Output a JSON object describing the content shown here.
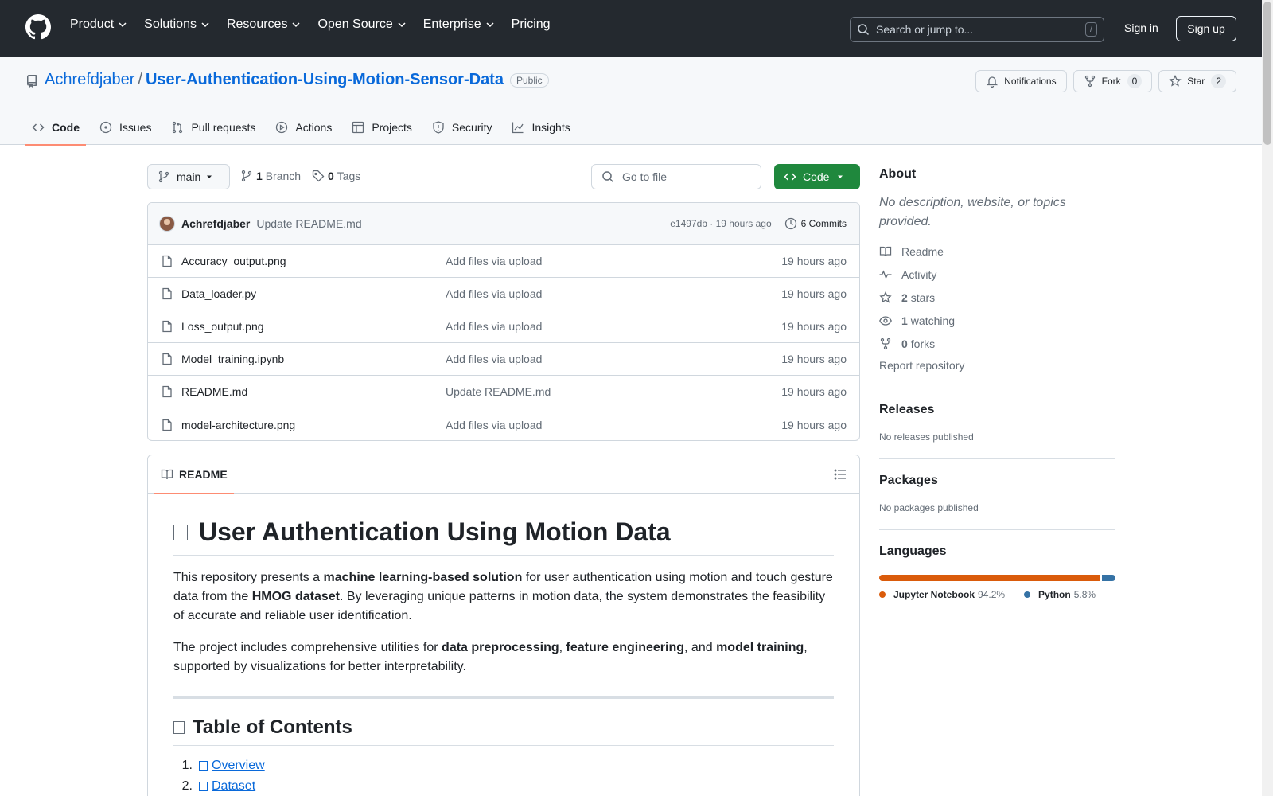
{
  "header": {
    "nav": [
      "Product",
      "Solutions",
      "Resources",
      "Open Source",
      "Enterprise",
      "Pricing"
    ],
    "search_placeholder": "Search or jump to...",
    "search_shortcut": "/",
    "signin": "Sign in",
    "signup": "Sign up"
  },
  "repo": {
    "owner": "Achrefdjaber",
    "separator": "/",
    "name": "User-Authentication-Using-Motion-Sensor-Data",
    "visibility": "Public",
    "notifications": "Notifications",
    "fork_label": "Fork",
    "fork_count": "0",
    "star_label": "Star",
    "star_count": "2"
  },
  "tabs": [
    "Code",
    "Issues",
    "Pull requests",
    "Actions",
    "Projects",
    "Security",
    "Insights"
  ],
  "toolbar": {
    "branch": "main",
    "branch_count": "1",
    "branch_label": "Branch",
    "tag_count": "0",
    "tag_label": "Tags",
    "goto_placeholder": "Go to file",
    "code_button": "Code"
  },
  "commit": {
    "author": "Achrefdjaber",
    "message": "Update README.md",
    "meta": "e1497db · 19 hours ago",
    "commits": "6 Commits"
  },
  "files": [
    {
      "name": "Accuracy_output.png",
      "message": "Add files via upload",
      "time": "19 hours ago"
    },
    {
      "name": "Data_loader.py",
      "message": "Add files via upload",
      "time": "19 hours ago"
    },
    {
      "name": "Loss_output.png",
      "message": "Add files via upload",
      "time": "19 hours ago"
    },
    {
      "name": "Model_training.ipynb",
      "message": "Add files via upload",
      "time": "19 hours ago"
    },
    {
      "name": "README.md",
      "message": "Update README.md",
      "time": "19 hours ago"
    },
    {
      "name": "model-architecture.png",
      "message": "Add files via upload",
      "time": "19 hours ago"
    }
  ],
  "readme": {
    "tab": "README",
    "title": "User Authentication Using Motion Data",
    "p1": {
      "a": "This repository presents a ",
      "b": "machine learning-based solution",
      "c": " for user authentication using motion and touch gesture data from the ",
      "d": "HMOG dataset",
      "e": ". By leveraging unique patterns in motion data, the system demonstrates the feasibility of accurate and reliable user identification."
    },
    "p2": {
      "a": "The project includes comprehensive utilities for ",
      "b": "data preprocessing",
      "c": ", ",
      "d": "feature engineering",
      "e": ", and ",
      "f": "model training",
      "g": ", supported by visualizations for better interpretability."
    },
    "toc_title": "Table of Contents",
    "toc": [
      {
        "num": "1.",
        "label": "Overview"
      },
      {
        "num": "2.",
        "label": "Dataset"
      }
    ]
  },
  "sidebar": {
    "about_title": "About",
    "description": "No description, website, or topics provided.",
    "readme": "Readme",
    "activity": "Activity",
    "stars_count": "2",
    "stars_label": "stars",
    "watching_count": "1",
    "watching_label": "watching",
    "forks_count": "0",
    "forks_label": "forks",
    "report": "Report repository",
    "releases_title": "Releases",
    "releases_note": "No releases published",
    "packages_title": "Packages",
    "packages_note": "No packages published",
    "languages_title": "Languages",
    "languages": [
      {
        "name": "Jupyter Notebook",
        "percent": "94.2%",
        "value": 94.2,
        "color": "#da5b0b"
      },
      {
        "name": "Python",
        "percent": "5.8%",
        "value": 5.8,
        "color": "#3572a5"
      }
    ]
  }
}
